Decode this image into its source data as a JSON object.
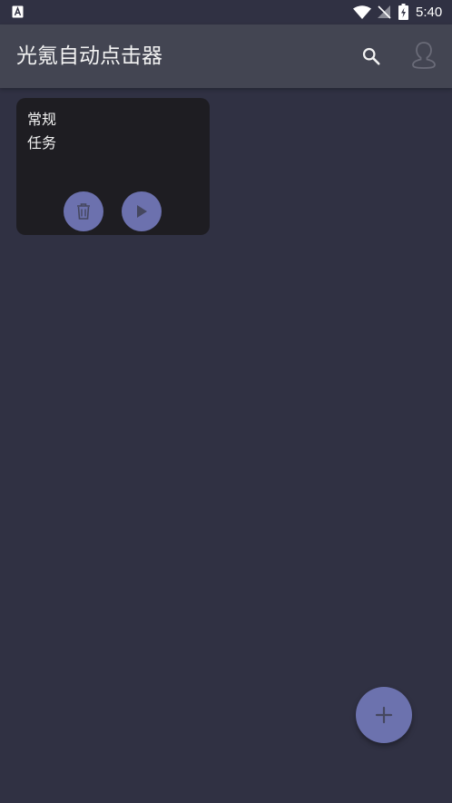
{
  "status_bar": {
    "time": "5:40",
    "icons": [
      "notification-a-icon",
      "wifi-icon",
      "no-signal-icon",
      "battery-charging-icon"
    ]
  },
  "app_bar": {
    "title": "光氪自动点击器",
    "actions": [
      "search-icon",
      "account-icon"
    ]
  },
  "tasks": [
    {
      "name": "常规任务",
      "actions": [
        "delete-icon",
        "play-icon"
      ]
    }
  ],
  "fab": {
    "icon": "plus-icon"
  },
  "colors": {
    "background": "#303143",
    "app_bar": "#434552",
    "card": "#1e1d22",
    "accent": "#6c71ae"
  }
}
